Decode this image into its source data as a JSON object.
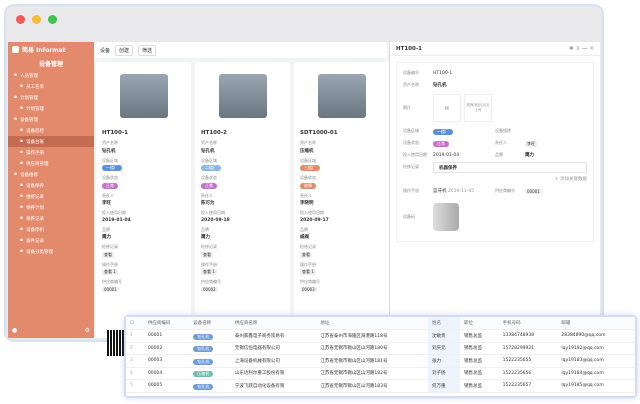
{
  "app": {
    "brand": "简易 Informat",
    "module": "设备管理",
    "breadcrumb": "设备",
    "btn_new": "创建",
    "btn_filter": "筛选"
  },
  "sidebar": [
    {
      "label": "人员管理",
      "sub": false
    },
    {
      "label": "员工名单",
      "sub": true
    },
    {
      "label": "计划管理",
      "sub": false
    },
    {
      "label": "计划管理",
      "sub": true
    },
    {
      "label": "设备管理",
      "sub": false
    },
    {
      "label": "设备巡检",
      "sub": true
    },
    {
      "label": "设备台账",
      "sub": true,
      "active": true
    },
    {
      "label": "操作手册",
      "sub": true
    },
    {
      "label": "供应商管理",
      "sub": true
    },
    {
      "label": "设备维修",
      "sub": false
    },
    {
      "label": "设备保养",
      "sub": true
    },
    {
      "label": "维修记录",
      "sub": true
    },
    {
      "label": "保养计划",
      "sub": true
    },
    {
      "label": "保养记录",
      "sub": true
    },
    {
      "label": "设备停机",
      "sub": true
    },
    {
      "label": "备件记录",
      "sub": true
    },
    {
      "label": "设备分类管理",
      "sub": true
    }
  ],
  "labels": {
    "asset": "资产名称",
    "area": "设备区域",
    "status": "设备状态",
    "owner": "责任人",
    "date": "投入使用日期",
    "brand": "品牌",
    "record": "检修记录",
    "manual": "操作手册",
    "supplier": "供应商编号",
    "qrcode": "设备码"
  },
  "cards": [
    {
      "code": "HT100-1",
      "asset": "钻孔机",
      "area": "一楼厂",
      "area_color": "#5b8fd6",
      "status": "正常",
      "status_color": "#c671c8",
      "owner": "李旺",
      "date": "2019-01-04",
      "brand": "鹰力",
      "record": "查看",
      "manual": "查看 1",
      "supplier": "00001"
    },
    {
      "code": "HT100-2",
      "asset": "钻孔机",
      "area": "二楼厂",
      "area_color": "#8ab8e0",
      "status": "正常",
      "status_color": "#c671c8",
      "owner": "陈可为",
      "date": "2020-09-18",
      "brand": "鹰力",
      "record": "查看",
      "manual": "查看 1",
      "supplier": "00002"
    },
    {
      "code": "SDT1000-01",
      "asset": "压缩机",
      "area": "三楼厂",
      "area_color": "#e08b6a",
      "status": "故障",
      "status_color": "#e08b6a",
      "owner": "李晓明",
      "date": "2020-09-17",
      "brand": "威阀",
      "record": "查看",
      "manual": "查看 1",
      "supplier": "00003"
    }
  ],
  "detail": {
    "title": "HT100-1",
    "code_label": "设备编号",
    "code": "HT100-1",
    "asset": "钻孔机",
    "pic_label": "图片",
    "upload": "拖拽/粘贴/点击上传",
    "area": "一楼厂",
    "desc_label": "设备描述",
    "status": "正常",
    "owner": "李旺",
    "date": "2019-01-04",
    "brand": "鹰力",
    "record": "机器保养",
    "add_link": "+ 添加关联数据",
    "manual_file": "蓝牙机",
    "manual_time": "2019-11-45",
    "supplier": "00001"
  },
  "table": {
    "headers": [
      "供应商编码",
      "设备名称",
      "供应商名称",
      "地址",
      "姓名",
      "职位",
      "手机号码",
      "邮箱"
    ],
    "rows": [
      [
        "1",
        "00001",
        "钻孔机",
        "泰州家鑫电子商务贸易有",
        "江苏省泰州市海陵区海港路118号",
        "沈敏贵",
        "销售总监",
        "13384748938",
        "28384890@qq.com"
      ],
      [
        "2",
        "00002",
        "钻孔机",
        "无锡信恒电器有限公司",
        "江苏省无锡市锡山区山河路180号",
        "刘庆元",
        "销售总监",
        "15728299921",
        "lqy19182@qq.com"
      ],
      [
        "3",
        "00003",
        "钻孔机",
        "上海设备机械有限公司",
        "江苏省无锡市锡山区山河路181号",
        "张力",
        "销售总监",
        "1522235655",
        "lqy19183@qq.com"
      ],
      [
        "4",
        "00004",
        "压缩机",
        "山东达利尔重工股份有限",
        "江苏省无锡市锡山区山河路182号",
        "刘子扬",
        "销售总监",
        "1522235656",
        "lqy19184@qq.com"
      ],
      [
        "5",
        "00005",
        "钻孔机",
        "宁波飞跃自动化设备有限",
        "江苏省无锡市锡山区山河路183号",
        "何万重",
        "销售总监",
        "1522235657",
        "lqy19185@qq.com"
      ]
    ],
    "tag_colors": {
      "钻孔机": "#6f9bd8",
      "压缩机": "#6bbfa8"
    }
  }
}
